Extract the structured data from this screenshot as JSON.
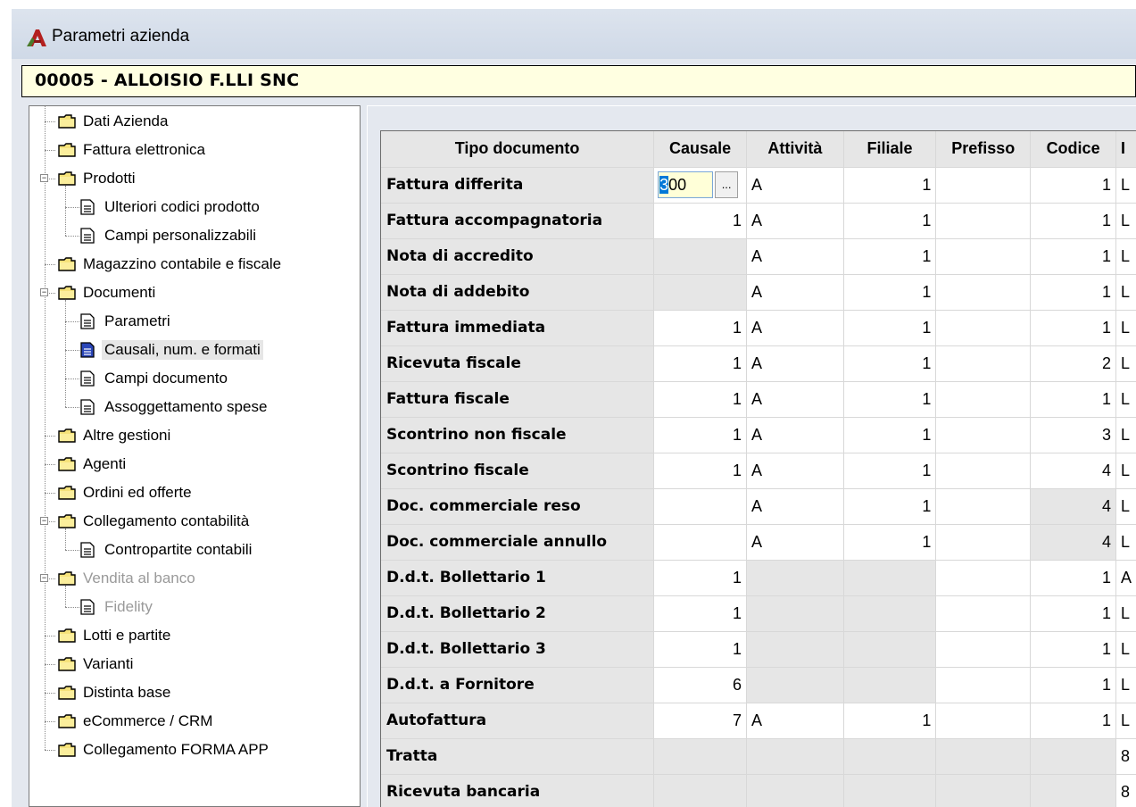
{
  "window": {
    "title": "Parametri azienda"
  },
  "company": {
    "label": "00005 - ALLOISIO F.LLI SNC"
  },
  "tree": {
    "items": [
      {
        "label": "Dati Azienda",
        "type": "folder",
        "level": 0
      },
      {
        "label": "Fattura elettronica",
        "type": "folder",
        "level": 0
      },
      {
        "label": "Prodotti",
        "type": "folder",
        "level": 0,
        "expanded": true
      },
      {
        "label": "Ulteriori codici prodotto",
        "type": "doc",
        "level": 1
      },
      {
        "label": "Campi personalizzabili",
        "type": "doc",
        "level": 1
      },
      {
        "label": "Magazzino contabile e fiscale",
        "type": "folder",
        "level": 0
      },
      {
        "label": "Documenti",
        "type": "folder",
        "level": 0,
        "expanded": true
      },
      {
        "label": "Parametri",
        "type": "doc",
        "level": 1
      },
      {
        "label": "Causali, num. e formati",
        "type": "doc",
        "level": 1,
        "selected": true
      },
      {
        "label": "Campi documento",
        "type": "doc",
        "level": 1
      },
      {
        "label": "Assoggettamento spese",
        "type": "doc",
        "level": 1
      },
      {
        "label": "Altre gestioni",
        "type": "folder",
        "level": 0
      },
      {
        "label": "Agenti",
        "type": "folder",
        "level": 0
      },
      {
        "label": "Ordini ed offerte",
        "type": "folder",
        "level": 0
      },
      {
        "label": "Collegamento contabilità",
        "type": "folder",
        "level": 0,
        "expanded": true
      },
      {
        "label": "Contropartite contabili",
        "type": "doc",
        "level": 1
      },
      {
        "label": "Vendita al banco",
        "type": "folder",
        "level": 0,
        "expanded": true,
        "disabled": true
      },
      {
        "label": "Fidelity",
        "type": "doc",
        "level": 1,
        "disabled": true
      },
      {
        "label": "Lotti e partite",
        "type": "folder",
        "level": 0
      },
      {
        "label": "Varianti",
        "type": "folder",
        "level": 0
      },
      {
        "label": "Distinta base",
        "type": "folder",
        "level": 0
      },
      {
        "label": "eCommerce / CRM",
        "type": "folder",
        "level": 0
      },
      {
        "label": "Collegamento FORMA APP",
        "type": "folder",
        "level": 0
      }
    ]
  },
  "grid": {
    "columns": [
      "Tipo documento",
      "Causale",
      "Attività",
      "Filiale",
      "Prefisso",
      "Codice",
      "I"
    ],
    "editing": {
      "row": 0,
      "value_selected": "3",
      "value_rest": "00",
      "button_label": "..."
    },
    "rows": [
      {
        "doc": "Fattura differita",
        "causale": "300",
        "attivita": "A",
        "filiale": "1",
        "prefisso": "",
        "codice": "1",
        "extra": "L"
      },
      {
        "doc": "Fattura accompagnatoria",
        "causale": "1",
        "attivita": "A",
        "filiale": "1",
        "prefisso": "",
        "codice": "1",
        "extra": "L"
      },
      {
        "doc": "Nota di accredito",
        "causale": "",
        "attivita": "A",
        "filiale": "1",
        "prefisso": "",
        "codice": "1",
        "extra": "L",
        "gray": [
          "causale"
        ]
      },
      {
        "doc": "Nota di addebito",
        "causale": "",
        "attivita": "A",
        "filiale": "1",
        "prefisso": "",
        "codice": "1",
        "extra": "L",
        "gray": [
          "causale"
        ]
      },
      {
        "doc": "Fattura immediata",
        "causale": "1",
        "attivita": "A",
        "filiale": "1",
        "prefisso": "",
        "codice": "1",
        "extra": "L"
      },
      {
        "doc": "Ricevuta fiscale",
        "causale": "1",
        "attivita": "A",
        "filiale": "1",
        "prefisso": "",
        "codice": "2",
        "extra": "L"
      },
      {
        "doc": "Fattura fiscale",
        "causale": "1",
        "attivita": "A",
        "filiale": "1",
        "prefisso": "",
        "codice": "1",
        "extra": "L"
      },
      {
        "doc": "Scontrino non fiscale",
        "causale": "1",
        "attivita": "A",
        "filiale": "1",
        "prefisso": "",
        "codice": "3",
        "extra": "L"
      },
      {
        "doc": "Scontrino fiscale",
        "causale": "1",
        "attivita": "A",
        "filiale": "1",
        "prefisso": "",
        "codice": "4",
        "extra": "L"
      },
      {
        "doc": "Doc. commerciale reso",
        "causale": "",
        "attivita": "A",
        "filiale": "1",
        "prefisso": "",
        "codice": "4",
        "extra": "L",
        "gray": [
          "codice"
        ]
      },
      {
        "doc": "Doc. commerciale annullo",
        "causale": "",
        "attivita": "A",
        "filiale": "1",
        "prefisso": "",
        "codice": "4",
        "extra": "L",
        "gray": [
          "codice"
        ]
      },
      {
        "doc": "D.d.t. Bollettario 1",
        "causale": "1",
        "attivita": "",
        "filiale": "",
        "prefisso": "",
        "codice": "1",
        "extra": "A",
        "gray": [
          "attivita",
          "filiale"
        ]
      },
      {
        "doc": "D.d.t. Bollettario 2",
        "causale": "1",
        "attivita": "",
        "filiale": "",
        "prefisso": "",
        "codice": "1",
        "extra": "L",
        "gray": [
          "attivita",
          "filiale"
        ]
      },
      {
        "doc": "D.d.t. Bollettario 3",
        "causale": "1",
        "attivita": "",
        "filiale": "",
        "prefisso": "",
        "codice": "1",
        "extra": "L",
        "gray": [
          "attivita",
          "filiale"
        ]
      },
      {
        "doc": "D.d.t. a Fornitore",
        "causale": "6",
        "attivita": "",
        "filiale": "",
        "prefisso": "",
        "codice": "1",
        "extra": "L",
        "gray": [
          "attivita",
          "filiale"
        ]
      },
      {
        "doc": "Autofattura",
        "causale": "7",
        "attivita": "A",
        "filiale": "1",
        "prefisso": "",
        "codice": "1",
        "extra": "L"
      },
      {
        "doc": "Tratta",
        "causale": "",
        "attivita": "",
        "filiale": "",
        "prefisso": "",
        "codice": "",
        "extra": "8",
        "gray": [
          "causale",
          "attivita",
          "filiale",
          "prefisso",
          "codice"
        ]
      },
      {
        "doc": "Ricevuta bancaria",
        "causale": "",
        "attivita": "",
        "filiale": "",
        "prefisso": "",
        "codice": "",
        "extra": "8",
        "gray": [
          "causale",
          "attivita",
          "filiale",
          "prefisso",
          "codice"
        ]
      }
    ]
  },
  "colors": {
    "selection": "#0078d7",
    "gray_cell": "#e6e6e6",
    "company_bar": "#ffffe1",
    "edit_bg": "#ffffd8"
  }
}
